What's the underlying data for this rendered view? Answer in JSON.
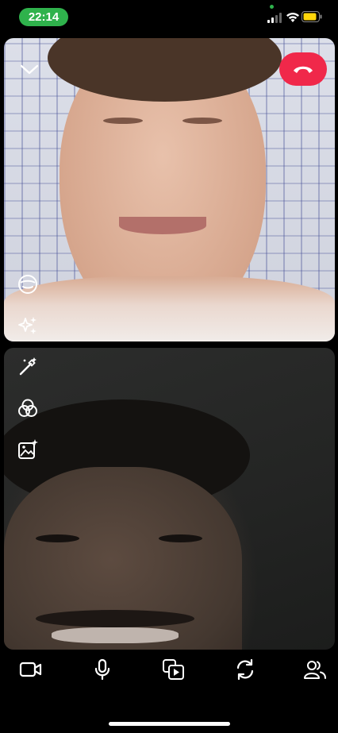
{
  "status_bar": {
    "time": "22:14",
    "time_pill_color": "#2fb24c",
    "battery_color": "#ffd60a"
  },
  "call": {
    "end_call_color": "#f0284a",
    "remote_tile_icons": [
      "chevron-down-icon",
      "end-call-icon",
      "face-lens-icon",
      "sparkles-icon"
    ],
    "local_tile_icons": [
      "magic-wand-icon",
      "color-filter-icon",
      "image-sparkle-icon"
    ]
  },
  "toolbar": {
    "icons": [
      "video-camera-icon",
      "microphone-icon",
      "share-media-icon",
      "switch-camera-icon",
      "participants-icon"
    ]
  }
}
